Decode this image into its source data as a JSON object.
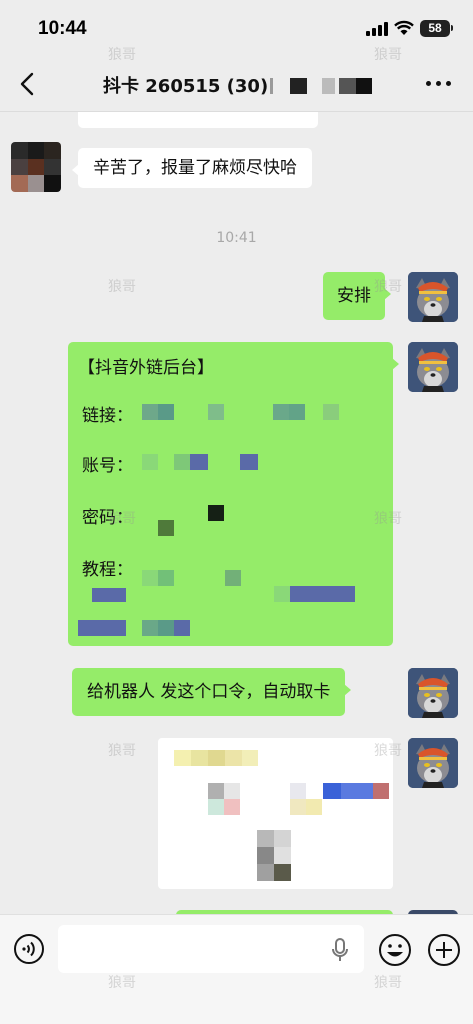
{
  "status_bar": {
    "time": "10:44",
    "battery": "58"
  },
  "header": {
    "title": "抖卡 260515 (30)"
  },
  "messages": {
    "partial_top_text": "",
    "msg1": "辛苦了，报量了麻烦尽快哈",
    "time1": "10:41",
    "msg2": "安排",
    "msg3_title": "【抖音外链后台】",
    "msg3_link_label": "链接：",
    "msg3_account_label": "账号：",
    "msg3_password_label": "密码：",
    "msg3_tutorial_label": "教程：",
    "msg4": "给机器人 发这个口令，自动取卡"
  },
  "watermark": "狼哥",
  "input": {
    "placeholder": ""
  },
  "colors": {
    "sent_bubble": "#95ec69",
    "received_bubble": "#ffffff",
    "background": "#ededed"
  }
}
